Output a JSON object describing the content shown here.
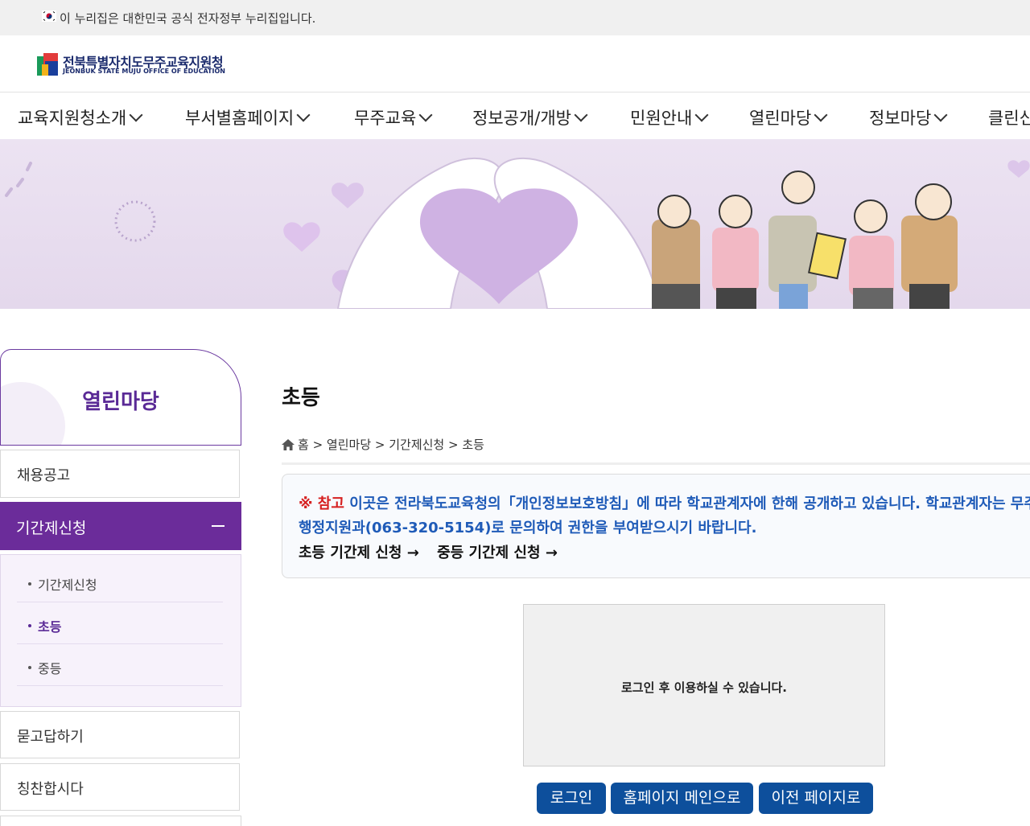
{
  "gov_bar": {
    "text": "이 누리집은 대한민국 공식 전자정부 누리집입니다."
  },
  "logo": {
    "name_ko": "전북특별자치도무주교육지원청",
    "name_en": "JEONBUK STATE MUJU OFFICE OF EDUCATION"
  },
  "gnb": {
    "items": [
      "교육지원청소개",
      "부서별홈페이지",
      "무주교육",
      "정보공개/개방",
      "민원안내",
      "열린마당",
      "정보마당",
      "클린신"
    ]
  },
  "lnb": {
    "title": "열린마당",
    "items": [
      "채용공고",
      "기간제신청",
      "묻고답하기",
      "칭찬합시다"
    ],
    "sub_items": [
      "기간제신청",
      "초등",
      "중등"
    ],
    "active_sub": "초등"
  },
  "content": {
    "title": "초등",
    "breadcrumb": {
      "home": "홈",
      "path": "> 열린마당 > 기간제신청 > 초등"
    },
    "notice": {
      "mark": "※",
      "ref_label": "참고",
      "line1": "이곳은 전라북도교육청의「개인정보보호방침」에 따라 학교관계자에 한해 공개하고 있습니다. 학교관계자는 무주",
      "line2": "행정지원과(063-320-5154)로 문의하여 권한을 부여받으시기 바랍니다.",
      "link1": "초등 기간제 신청 →",
      "link2": "중등 기간제 신청 →"
    },
    "login_message": "로그인 후 이용하실 수 있습니다.",
    "buttons": {
      "login": "로그인",
      "home": "홈페이지 메인으로",
      "back": "이전 페이지로"
    }
  },
  "colors": {
    "purple": "#6b2c9a",
    "blue_button": "#0d4f9c",
    "notice_blue": "#1f5bb8",
    "notice_red": "#d62020"
  }
}
